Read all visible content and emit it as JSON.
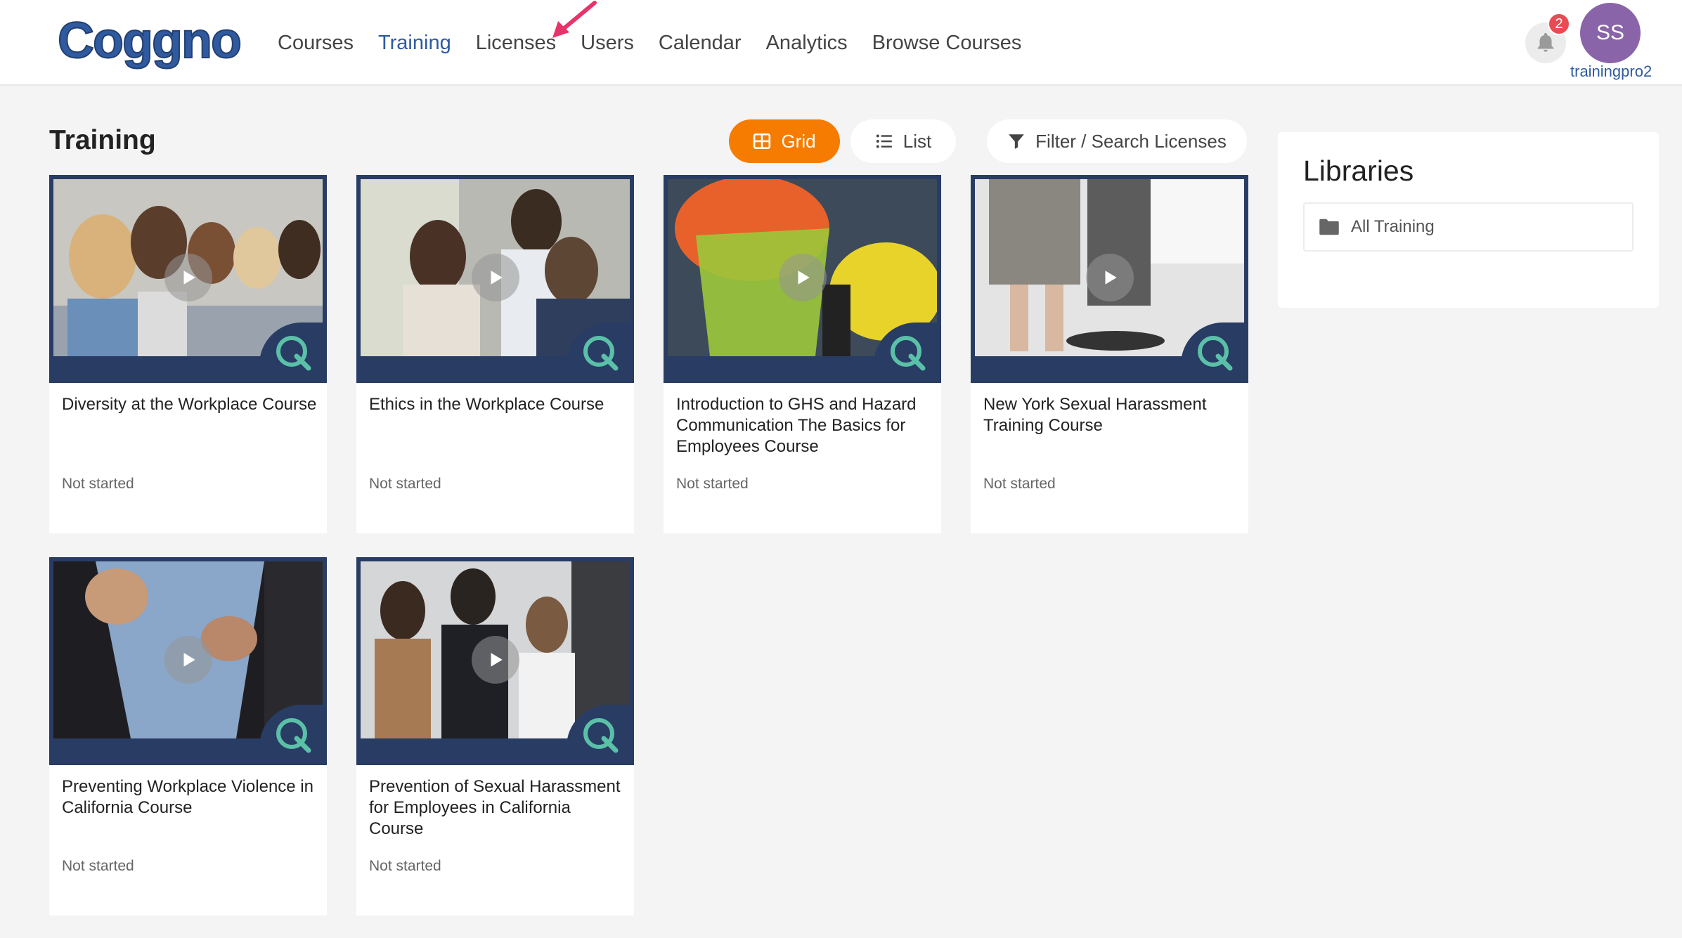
{
  "brand": {
    "logo_text": "Coggno"
  },
  "nav": {
    "items": [
      {
        "label": "Courses",
        "active": false
      },
      {
        "label": "Training",
        "active": true
      },
      {
        "label": "Licenses",
        "active": false
      },
      {
        "label": "Users",
        "active": false
      },
      {
        "label": "Calendar",
        "active": false
      },
      {
        "label": "Analytics",
        "active": false
      },
      {
        "label": "Browse Courses",
        "active": false
      }
    ]
  },
  "user": {
    "notification_count": "2",
    "initials": "SS",
    "username": "trainingpro2"
  },
  "page": {
    "title": "Training"
  },
  "toolbar": {
    "grid_label": "Grid",
    "list_label": "List",
    "filter_label": "Filter / Search Licenses"
  },
  "courses": [
    {
      "title": "Diversity at the Workplace Course",
      "status": "Not started"
    },
    {
      "title": "Ethics in the Workplace Course",
      "status": "Not started"
    },
    {
      "title": "Introduction to GHS and Hazard Communication The Basics for Employees Course",
      "status": "Not started"
    },
    {
      "title": "New York Sexual Harassment Training Course",
      "status": "Not started"
    },
    {
      "title": "Preventing Workplace Violence in California Course",
      "status": "Not started"
    },
    {
      "title": "Prevention of Sexual Harassment for Employees in California Course",
      "status": "Not started"
    }
  ],
  "libraries": {
    "title": "Libraries",
    "items": [
      {
        "label": "All Training"
      }
    ]
  },
  "colors": {
    "accent": "#f57c00",
    "nav_active": "#2f5aa0",
    "card_frame": "#283c64",
    "avatar": "#8a64a8",
    "badge": "#e94b55"
  }
}
